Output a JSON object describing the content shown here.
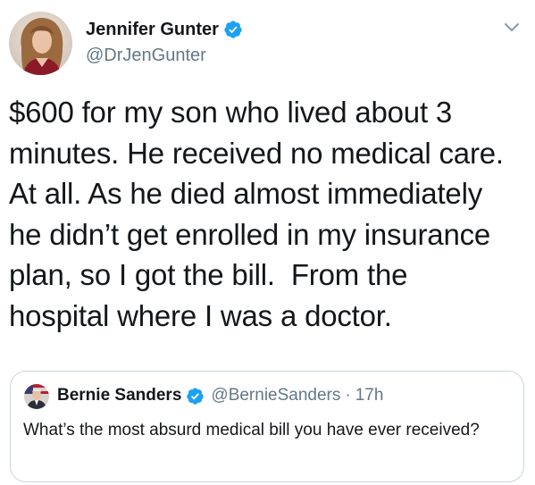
{
  "tweet": {
    "author": {
      "display_name": "Jennifer Gunter",
      "handle": "@DrJenGunter",
      "verified": true
    },
    "text": "$600 for my son who lived about 3\nminutes. He received no medical care.\nAt all. As he died almost immediately\nhe didn’t get enrolled in my insurance\nplan, so I got the bill.  From the\nhospital where I was a doctor.",
    "quoted_tweet": {
      "display_name": "Bernie Sanders",
      "handle": "@BernieSanders",
      "separator": "·",
      "time": "17h",
      "verified": true,
      "text": "What’s the most absurd medical bill you have ever received?"
    }
  },
  "colors": {
    "text_primary": "#14171a",
    "text_secondary": "#657786",
    "verified_blue": "#1da1f2",
    "border": "#ccd6dd"
  },
  "icons": {
    "verified": "verified-badge-icon",
    "menu": "chevron-down-icon"
  }
}
